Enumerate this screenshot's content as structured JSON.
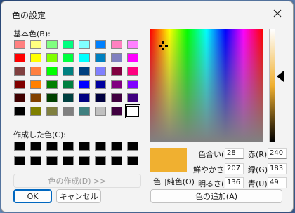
{
  "dialog": {
    "title": "色の設定",
    "close_label": "close"
  },
  "basic_colors": {
    "label": "基本色(B):",
    "swatches": [
      "#ff8080",
      "#ffff80",
      "#80ff80",
      "#00ff80",
      "#80ffff",
      "#0080ff",
      "#ff80c0",
      "#ff80ff",
      "#ff0000",
      "#ffff00",
      "#80ff00",
      "#00ff40",
      "#00ffff",
      "#0080c0",
      "#8080c0",
      "#ff00ff",
      "#804040",
      "#ff8040",
      "#00ff00",
      "#008080",
      "#004080",
      "#8080ff",
      "#800040",
      "#ff0080",
      "#800000",
      "#ff8000",
      "#008000",
      "#008040",
      "#0000ff",
      "#0000a0",
      "#800080",
      "#8000ff",
      "#400000",
      "#804000",
      "#004000",
      "#004040",
      "#000080",
      "#000040",
      "#400040",
      "#400080",
      "#000000",
      "#808000",
      "#808040",
      "#808080",
      "#408080",
      "#c0c0c0",
      "#400040",
      "#ffffff"
    ],
    "selected_index": 47
  },
  "custom_colors": {
    "label": "作成した色(C):",
    "swatches": [
      "#000000",
      "#000000",
      "#000000",
      "#000000",
      "#000000",
      "#000000",
      "#000000",
      "#000000",
      "#000000",
      "#000000",
      "#000000",
      "#000000",
      "#000000",
      "#000000",
      "#000000",
      "#000000"
    ]
  },
  "buttons": {
    "define_custom": "色の作成(D) >>",
    "ok": "OK",
    "cancel": "キャンセル",
    "add_custom": "色の追加(A)"
  },
  "preview": {
    "color": "#f0b030",
    "label_color": "色",
    "label_solid": "|純色(O)"
  },
  "values": {
    "hue_label": "色合い(E):",
    "hue": "28",
    "sat_label": "鮮やかさ(S):",
    "sat": "207",
    "lum_label": "明るさ(L):",
    "lum": "136",
    "red_label": "赤(R):",
    "red": "240",
    "green_label": "緑(G):",
    "green": "183",
    "blue_label": "青(U):",
    "blue": "49"
  }
}
